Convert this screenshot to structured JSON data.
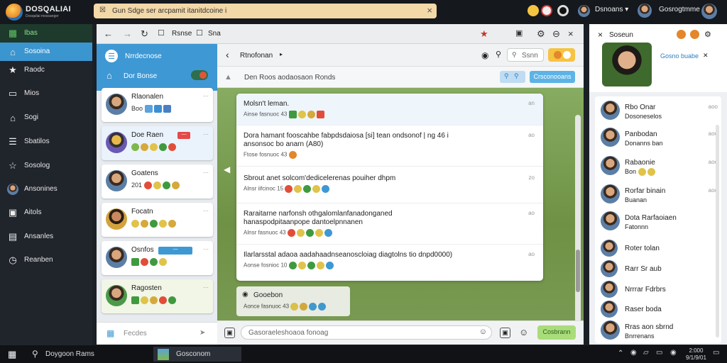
{
  "topbar": {
    "app_title": "DOSQALIAI",
    "app_subtitle": "Dosqaliai mossanger",
    "notification_text": "Gun Sdge ser arcpamit itanitdcoine i",
    "user1_name": "Dsnoans",
    "user2_name": "Gosrogtmme"
  },
  "sidebar": {
    "items": [
      {
        "label": "Ibas",
        "icon": "grid-icon"
      },
      {
        "label": "Sosoina",
        "icon": "home-icon"
      },
      {
        "label": "Raodc",
        "icon": "star-icon"
      },
      {
        "label": "Mios",
        "icon": "window-icon"
      },
      {
        "label": "Sogi",
        "icon": "house-icon"
      },
      {
        "label": "Sbatilos",
        "icon": "list-icon"
      },
      {
        "label": "Sosolog",
        "icon": "star-outline-icon"
      },
      {
        "label": "Ansonines",
        "icon": "avatar-icon"
      },
      {
        "label": "Aitols",
        "icon": "building-icon"
      },
      {
        "label": "Ansanles",
        "icon": "chart-icon"
      },
      {
        "label": "Reanben",
        "icon": "clock-icon"
      }
    ]
  },
  "nav": {
    "address": "Rsnse",
    "tab": "Sna"
  },
  "chatlist": {
    "header_title": "Nrrdecnose",
    "section_title": "Dor Bonse",
    "items": [
      {
        "name": "Rlaonalen",
        "sub": "Boo",
        "time": "",
        "badge": ""
      },
      {
        "name": "Doe Raen",
        "sub": "",
        "time": "",
        "badge": "—"
      },
      {
        "name": "Goatens",
        "sub": "201",
        "time": "",
        "badge": ""
      },
      {
        "name": "Focatn",
        "sub": "",
        "time": "",
        "badge": ""
      },
      {
        "name": "Osnfos",
        "sub": "",
        "time": "",
        "badge": "—"
      },
      {
        "name": "Ragosten",
        "sub": "",
        "time": "",
        "badge": ""
      }
    ],
    "footer_label": "Fecdes"
  },
  "conversation": {
    "title": "Rtnofonan",
    "search_placeholder": "Ssnn",
    "subheader_text": "Den Roos aodaosaon Ronds",
    "subheader_button": "Crsconooans",
    "messages": [
      {
        "text": "Molsn't leman.",
        "meta": "Ainse fasnuoc 43",
        "time": "an"
      },
      {
        "text": "Dora hamant fooscahbe fabpdsdaiosa [si] tean ondsonof | ng 46 i",
        "text2": "ansonsoc bo anarn (A80)",
        "meta": "Ftose fosnuoc 43",
        "time": "ao"
      },
      {
        "text": "Sbrout anet solcom'dedicelerenas pouiher dhpm",
        "meta": "Alnsr iifcinoc 15",
        "time": "zo"
      },
      {
        "text": "Raraitarne narfonsh othgalomlanfanadonganed",
        "text2": "hanaspodpitaanpope dantoelpnnanen",
        "meta": "Alnsr fasnuoc 43",
        "time": "ao"
      },
      {
        "text": "Ilarlarsstal adaoa aadahaadnseanoscloiag diagtolns tio dnpd0000)",
        "meta": "Aonse fosnioc 10",
        "time": "ao"
      }
    ],
    "preview": {
      "title": "Gooebon",
      "meta": "Aonce fasnuoc 43"
    },
    "composer_placeholder": "Gasoraeleshoaoa fonoag",
    "send_label": "Cosbrann"
  },
  "rpanel": {
    "title": "Soseun",
    "profile_link": "Gosno buabe",
    "contacts": [
      {
        "name": "Rbo Onar",
        "sub": "Dosoneselos",
        "time": "aoo"
      },
      {
        "name": "Panbodan",
        "sub": "Donanns ban",
        "time": "aoo"
      },
      {
        "name": "Rabaonie",
        "sub": "Bon",
        "time": "aoo"
      },
      {
        "name": "Rorfar binain",
        "sub": "Buanan",
        "time": "aoo"
      },
      {
        "name": "Dota Rarfaoiaen",
        "sub": "Fatonnn",
        "time": ""
      },
      {
        "name": "Roter tolan",
        "sub": "",
        "time": ""
      },
      {
        "name": "Rarr Sr aub",
        "sub": "",
        "time": ""
      },
      {
        "name": "Nrrrar Fdrbrs",
        "sub": "",
        "time": ""
      },
      {
        "name": "Raser boda",
        "sub": "",
        "time": ""
      },
      {
        "name": "Rras aon sbrnd",
        "sub": "Bnrrenans",
        "time": ""
      }
    ]
  },
  "taskbar": {
    "search_text": "Doygoon Rams",
    "app_label": "Gosconom",
    "clock_time": "2:000",
    "clock_date": "9/1/9/01"
  },
  "colors": {
    "accent": "#3b95cf",
    "send": "#a9dc7a",
    "sidebar": "#20242b"
  }
}
